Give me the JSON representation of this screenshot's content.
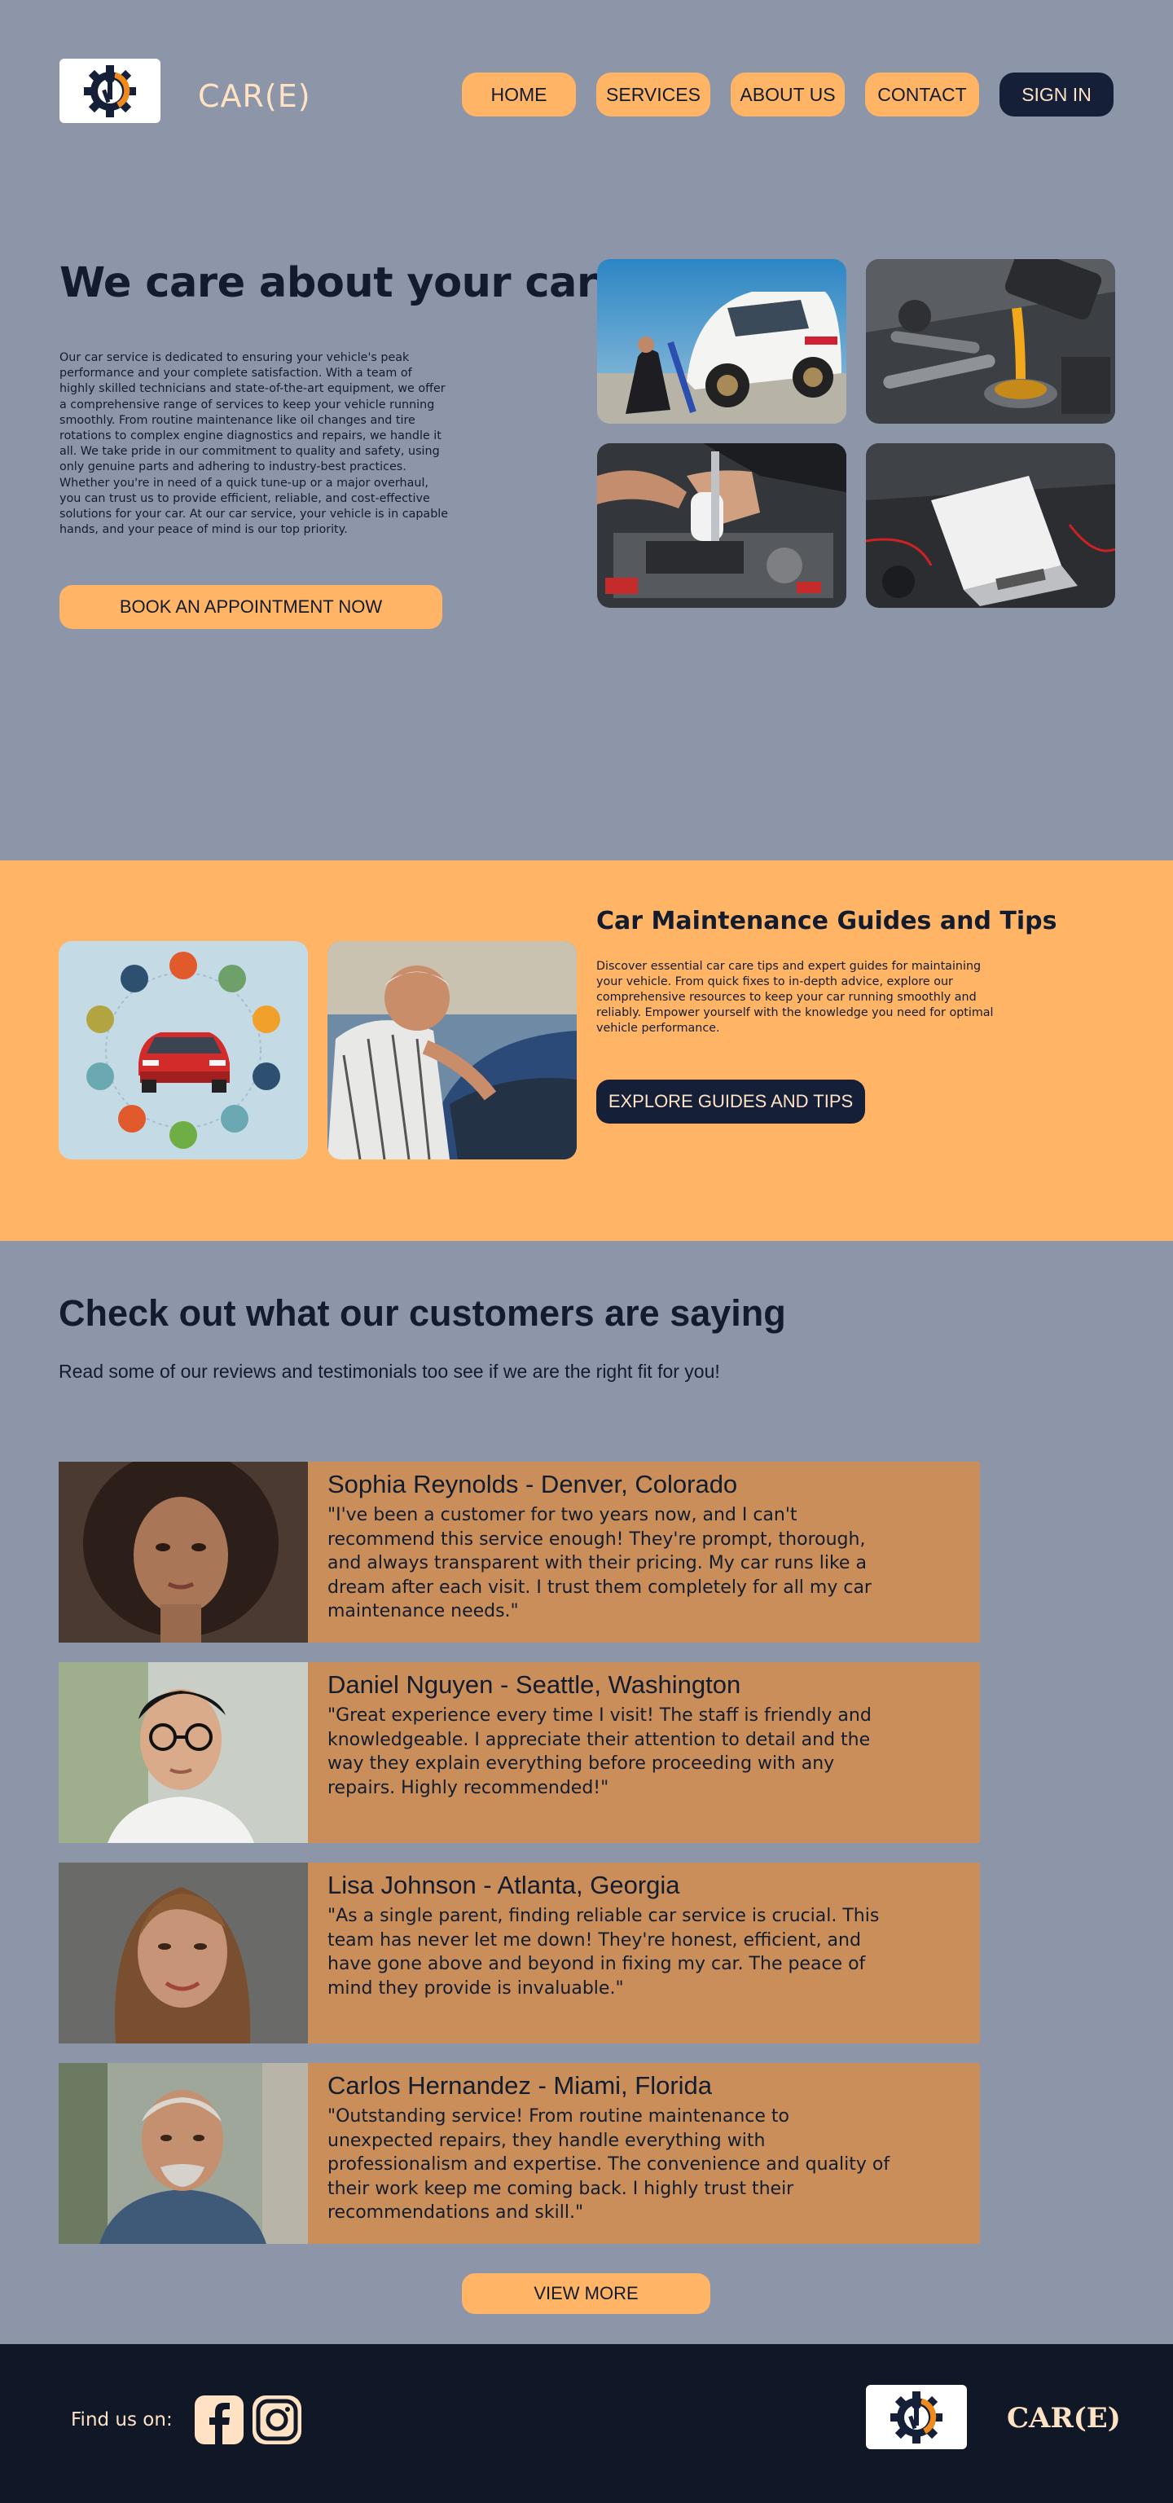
{
  "header": {
    "brand": "CAR(E)",
    "nav": {
      "home": "HOME",
      "services": "SERVICES",
      "about": "ABOUT US",
      "contact": "CONTACT",
      "signin": "SIGN IN"
    }
  },
  "hero": {
    "title": "We care about your car!",
    "body": "Our car service is dedicated to ensuring your vehicle's peak performance and your complete satisfaction. With a team of highly skilled technicians and state-of-the-art equipment, we offer a comprehensive range of services to keep your vehicle running smoothly. From routine maintenance like oil changes and tire rotations to complex engine diagnostics and repairs, we handle it all. We take pride in our commitment to quality and safety, using only genuine parts and adhering to industry-best practices. Whether you're in need of a quick tune-up or a major overhaul, you can trust us to provide efficient, reliable, and cost-effective solutions for your car. At our car service, your vehicle is in capable hands, and your peace of mind is our top priority.",
    "cta": "BOOK AN APPOINTMENT NOW"
  },
  "guides": {
    "title": "Car Maintenance Guides and Tips",
    "body": "Discover essential car care tips and expert guides for maintaining your vehicle. From quick fixes to in-depth advice, explore our comprehensive resources to keep your car running smoothly and reliably. Empower yourself with the knowledge you need for optimal vehicle performance.",
    "cta": "EXPLORE GUIDES AND TIPS"
  },
  "reviews": {
    "title": "Check out what our customers are saying",
    "subtitle": "Read some of our reviews and testimonials too see if we are the right fit for you!",
    "items": [
      {
        "name": "Sophia Reynolds - Denver, Colorado",
        "quote": "\"I've been a customer for two years now, and I can't recommend this service enough! They're prompt, thorough, and always transparent with their pricing. My car runs like a dream after each visit. I trust them completely for all my car maintenance needs.\""
      },
      {
        "name": "Daniel Nguyen - Seattle, Washington",
        "quote": "\"Great experience every time I visit! The staff is friendly and knowledgeable. I appreciate their attention to detail and the way they explain everything before proceeding with any repairs. Highly recommended!\""
      },
      {
        "name": "Lisa Johnson - Atlanta, Georgia",
        "quote": "\"As a single parent, finding reliable car service is crucial. This team has never let me down! They're honest, efficient, and have gone above and beyond in fixing my car. The peace of mind they provide is invaluable.\""
      },
      {
        "name": "Carlos Hernandez - Miami, Florida",
        "quote": "\"Outstanding service! From routine maintenance to unexpected repairs, they handle everything with professionalism and expertise. The convenience and quality of their work keep me coming back. I highly trust their recommendations and skill.\""
      }
    ],
    "more": "VIEW MORE"
  },
  "footer": {
    "find_us": "Find us on:",
    "brand": "CAR(E)",
    "social": [
      "facebook-icon",
      "instagram-icon"
    ]
  },
  "colors": {
    "page_bg": "#8c96a8",
    "accent_orange": "#ffb466",
    "navy": "#152038",
    "card_bg": "#c98e59",
    "footer_bg": "#101828"
  }
}
